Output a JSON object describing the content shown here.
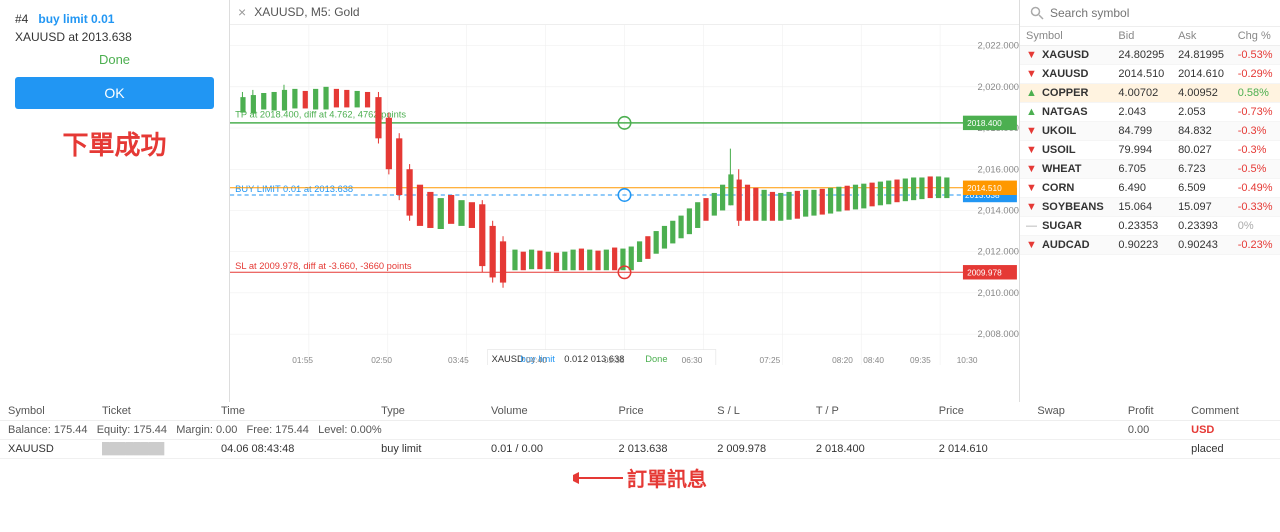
{
  "chart": {
    "title": "XAUUSD, M5: Gold",
    "close_label": "×",
    "tp_label": "TP at 2018.400, diff at 4.762, 4762 points",
    "buy_limit_label": "BUY LIMIT 0.01 at 2013.638",
    "sl_label": "SL at 2009.978, diff at -3.660, -3660 points",
    "price_2022": "2,022.000",
    "price_2020": "2,020.000",
    "price_2018": "2,018.000",
    "price_2016": "2,016.000",
    "price_2014": "2,014.000",
    "price_2012": "2,012.000",
    "price_2010": "2,010.000",
    "price_2008": "2,008.000",
    "price_2018_right": "2018.400",
    "price_2014_right": "2014.510",
    "price_2013_right": "2013.638",
    "price_2009_right": "2009.978",
    "times": [
      "01:55",
      "02:50",
      "03:45",
      "04:40",
      "05:35",
      "06:30",
      "07:25",
      "08:20 08:40",
      "09:35",
      "10:30"
    ],
    "tooltip_symbol": "XAUSD",
    "tooltip_type": "buy limit",
    "tooltip_vol": "0.01",
    "tooltip_price": "2 013.638",
    "tooltip_done": "Done"
  },
  "order_panel": {
    "order_id": "#4",
    "order_suffix": "buy limit 0.01",
    "order_desc": "XAUUSD at 2013.638",
    "done_label": "Done",
    "ok_label": "OK",
    "success_text": "下單成功"
  },
  "symbol_panel": {
    "search_placeholder": "Search symbol",
    "headers": {
      "symbol": "Symbol",
      "bid": "Bid",
      "ask": "Ask",
      "chg": "Chg %"
    },
    "symbols": [
      {
        "name": "XAGUSD",
        "arrow": "down",
        "bid": "24.80295",
        "ask": "24.81995",
        "chg": "-0.53%"
      },
      {
        "name": "XAUUSD",
        "arrow": "down",
        "bid": "2014.510",
        "ask": "2014.610",
        "chg": "-0.29%"
      },
      {
        "name": "COPPER",
        "arrow": "up",
        "bid": "4.00702",
        "ask": "4.00952",
        "chg": "0.58%",
        "highlight": true
      },
      {
        "name": "NATGAS",
        "arrow": "up",
        "bid": "2.043",
        "ask": "2.053",
        "chg": "-0.73%"
      },
      {
        "name": "UKOIL",
        "arrow": "down",
        "bid": "84.799",
        "ask": "84.832",
        "chg": "-0.3%"
      },
      {
        "name": "USOIL",
        "arrow": "down",
        "bid": "79.994",
        "ask": "80.027",
        "chg": "-0.3%"
      },
      {
        "name": "WHEAT",
        "arrow": "down",
        "bid": "6.705",
        "ask": "6.723",
        "chg": "-0.5%"
      },
      {
        "name": "CORN",
        "arrow": "down",
        "bid": "6.490",
        "ask": "6.509",
        "chg": "-0.49%"
      },
      {
        "name": "SOYBEANS",
        "arrow": "down",
        "bid": "15.064",
        "ask": "15.097",
        "chg": "-0.33%"
      },
      {
        "name": "SUGAR",
        "arrow": "neutral",
        "bid": "0.23353",
        "ask": "0.23393",
        "chg": "0%"
      },
      {
        "name": "AUDCAD",
        "arrow": "down",
        "bid": "0.90223",
        "ask": "0.90243",
        "chg": "-0.23%"
      }
    ]
  },
  "orders_table": {
    "headers": [
      "Symbol",
      "Ticket",
      "Time",
      "",
      "Type",
      "",
      "Volume",
      "",
      "Price",
      "S / L",
      "T / P",
      "",
      "Price",
      "Swap",
      "",
      "Profit",
      "Comment"
    ],
    "balance_row": {
      "label": "Balance: 175.44",
      "equity": "Equity: 175.44",
      "margin": "Margin: 0.00",
      "free": "Free: 175.44",
      "level": "Level: 0.00%",
      "profit_val": "0.00",
      "currency": "USD"
    },
    "order_row": {
      "symbol": "XAUUSD",
      "ticket": "████",
      "time": "04.06 08:43:48",
      "type": "buy limit",
      "volume": "0.01 / 0.00",
      "price": "2 013.638",
      "sl": "2 009.978",
      "tp": "2 018.400",
      "price2": "2 014.610",
      "swap": "",
      "profit": "",
      "comment": "placed"
    }
  },
  "annotation": {
    "order_msg_text": "訂單訊息"
  }
}
